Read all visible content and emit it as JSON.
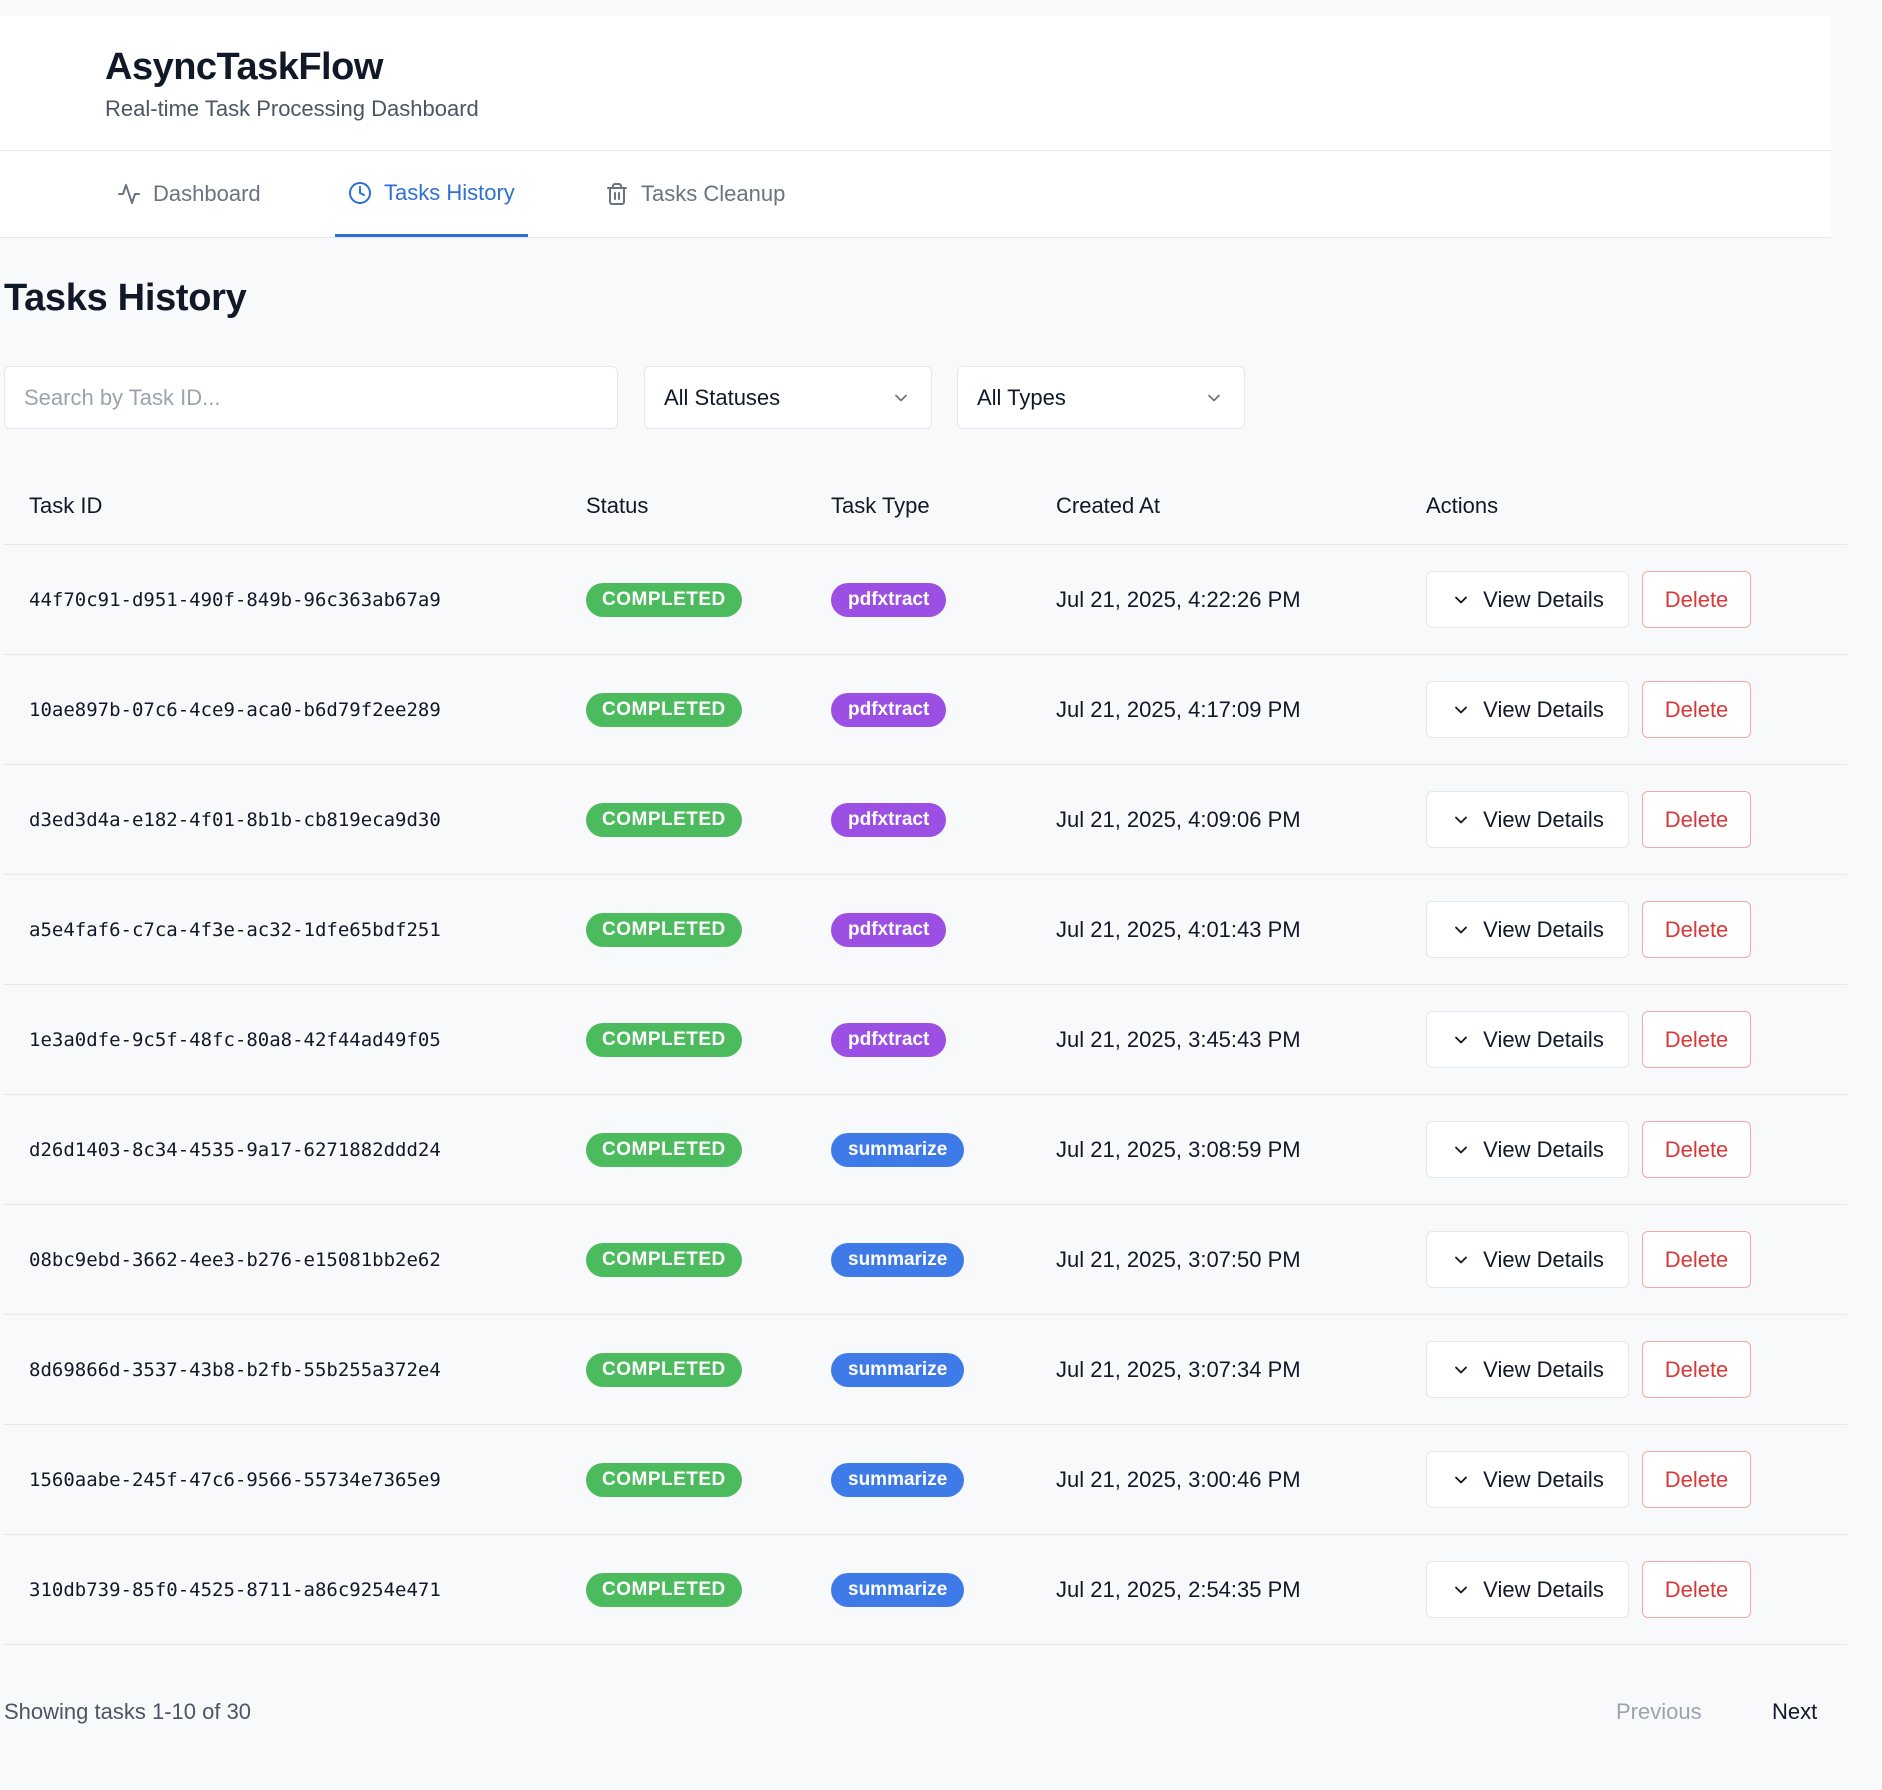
{
  "app": {
    "title": "AsyncTaskFlow",
    "subtitle": "Real-time Task Processing Dashboard"
  },
  "nav": {
    "tabs": [
      {
        "label": "Dashboard",
        "icon": "activity-icon",
        "active": false
      },
      {
        "label": "Tasks History",
        "icon": "clock-icon",
        "active": true
      },
      {
        "label": "Tasks Cleanup",
        "icon": "trash-icon",
        "active": false
      }
    ]
  },
  "page": {
    "title": "Tasks History"
  },
  "filters": {
    "search_placeholder": "Search by Task ID...",
    "search_value": "",
    "status_selected": "All Statuses",
    "type_selected": "All Types"
  },
  "table": {
    "columns": [
      "Task ID",
      "Status",
      "Task Type",
      "Created At",
      "Actions"
    ],
    "view_label": "View Details",
    "delete_label": "Delete",
    "rows": [
      {
        "id": "44f70c91-d951-490f-849b-96c363ab67a9",
        "status": "COMPLETED",
        "type": "pdfxtract",
        "created": "Jul 21, 2025, 4:22:26 PM"
      },
      {
        "id": "10ae897b-07c6-4ce9-aca0-b6d79f2ee289",
        "status": "COMPLETED",
        "type": "pdfxtract",
        "created": "Jul 21, 2025, 4:17:09 PM"
      },
      {
        "id": "d3ed3d4a-e182-4f01-8b1b-cb819eca9d30",
        "status": "COMPLETED",
        "type": "pdfxtract",
        "created": "Jul 21, 2025, 4:09:06 PM"
      },
      {
        "id": "a5e4faf6-c7ca-4f3e-ac32-1dfe65bdf251",
        "status": "COMPLETED",
        "type": "pdfxtract",
        "created": "Jul 21, 2025, 4:01:43 PM"
      },
      {
        "id": "1e3a0dfe-9c5f-48fc-80a8-42f44ad49f05",
        "status": "COMPLETED",
        "type": "pdfxtract",
        "created": "Jul 21, 2025, 3:45:43 PM"
      },
      {
        "id": "d26d1403-8c34-4535-9a17-6271882ddd24",
        "status": "COMPLETED",
        "type": "summarize",
        "created": "Jul 21, 2025, 3:08:59 PM"
      },
      {
        "id": "08bc9ebd-3662-4ee3-b276-e15081bb2e62",
        "status": "COMPLETED",
        "type": "summarize",
        "created": "Jul 21, 2025, 3:07:50 PM"
      },
      {
        "id": "8d69866d-3537-43b8-b2fb-55b255a372e4",
        "status": "COMPLETED",
        "type": "summarize",
        "created": "Jul 21, 2025, 3:07:34 PM"
      },
      {
        "id": "1560aabe-245f-47c6-9566-55734e7365e9",
        "status": "COMPLETED",
        "type": "summarize",
        "created": "Jul 21, 2025, 3:00:46 PM"
      },
      {
        "id": "310db739-85f0-4525-8711-a86c9254e471",
        "status": "COMPLETED",
        "type": "summarize",
        "created": "Jul 21, 2025, 2:54:35 PM"
      }
    ]
  },
  "pagination": {
    "summary": "Showing tasks 1-10 of 30",
    "previous_label": "Previous",
    "next_label": "Next"
  },
  "colors": {
    "accent": "#2f6fd6",
    "status_completed": "#4cbb5e",
    "type_pdfxtract": "#9b4fe3",
    "type_summarize": "#3f7be8",
    "danger": "#d93838"
  }
}
